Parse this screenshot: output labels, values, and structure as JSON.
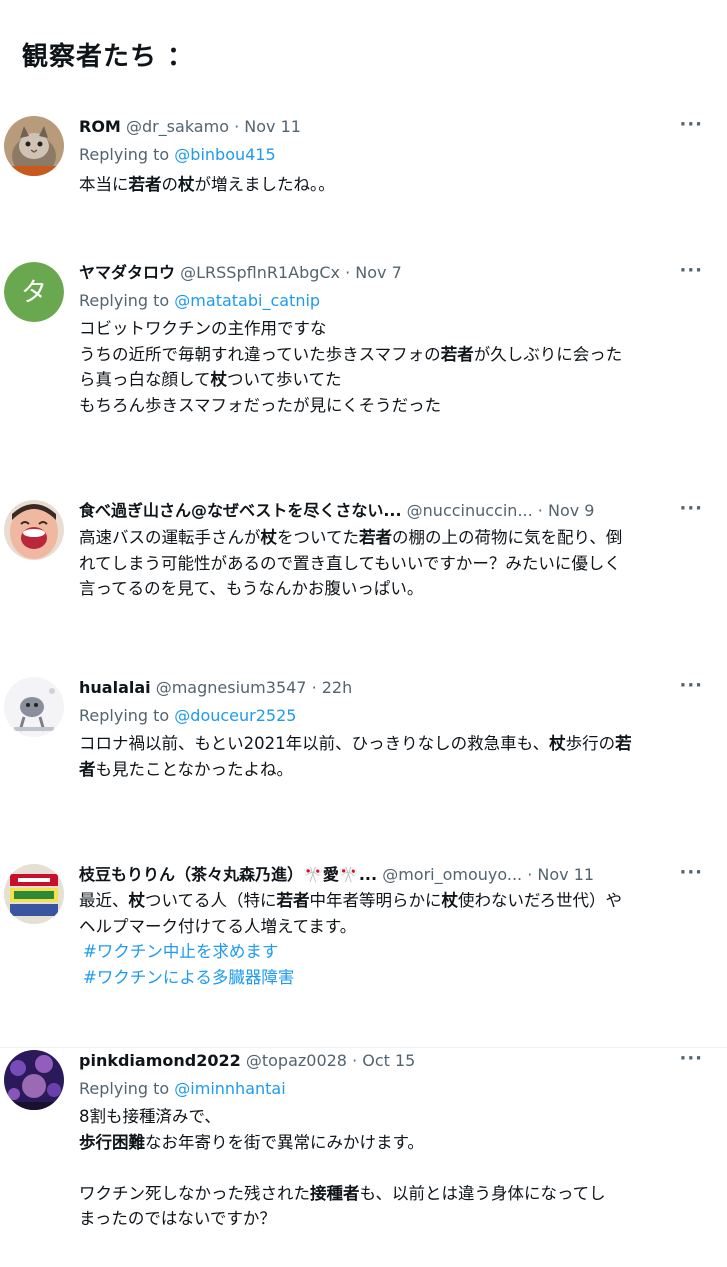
{
  "header": {
    "title": "観察者たち ："
  },
  "tweets": [
    {
      "name": "ROM",
      "handle": "@dr_sakamo",
      "sep": " · ",
      "date": "Nov 11",
      "reply_prefix": "Replying to ",
      "reply_to": "@binbou415",
      "lines": [
        [
          "本当に",
          "若者",
          "の",
          "杖",
          "が増えましたね。。"
        ]
      ]
    },
    {
      "name": "ヤマダタロウ",
      "handle": "@LRSSpflnR1AbgCx",
      "sep": " · ",
      "date": "Nov 7",
      "avatar_letter": "タ",
      "reply_prefix": "Replying to ",
      "reply_to": "@matatabi_catnip",
      "lines": [
        [
          "コビットワクチンの主作用ですな"
        ],
        [
          "うちの近所で毎朝すれ違っていた歩きスマフォの",
          "若者",
          "が久しぶりに会った"
        ],
        [
          "ら真っ白な顔して",
          "杖",
          "ついて歩いてた"
        ],
        [
          "もちろん歩きスマフォだったが見にくそうだった"
        ]
      ]
    },
    {
      "name": "食べ過ぎ山さん@なぜベストを尽くさない...",
      "handle": "@nuccinuccin...",
      "sep": " · ",
      "date": "Nov 9",
      "lines": [
        [
          "高速バスの運転手さんが",
          "杖",
          "をついてた",
          "若者",
          "の棚の上の荷物に気を配り、倒"
        ],
        [
          "れてしまう可能性があるので置き直してもいいですかー？みたいに優しく"
        ],
        [
          "言ってるのを見て、もうなんかお腹いっぱい。"
        ]
      ]
    },
    {
      "name": "hualalai",
      "handle": "@magnesium3547",
      "sep": " · ",
      "date": "22h",
      "reply_prefix": "Replying to ",
      "reply_to": "@douceur2525",
      "lines": [
        [
          "コロナ禍以前、もとい2021年以前、ひっきりなしの救急車も、",
          "杖",
          "歩行の",
          "若"
        ],
        [
          "",
          "者",
          "も見たことなかったよね。"
        ]
      ]
    },
    {
      "name": "枝豆もりりん（茶々丸森乃進）🎌愛🎌...",
      "handle": "@mori_omouyo...",
      "sep": " · ",
      "date": "Nov 11",
      "lines": [
        [
          "最近、",
          "杖",
          "ついてる人（特に",
          "若者",
          "中年者等明らかに",
          "杖",
          "使わないだろ世代）や"
        ],
        [
          "ヘルプマーク付けてる人増えてます。"
        ]
      ],
      "hashtags": [
        "#ワクチン中止を求めます",
        "#ワクチンによる多臓器障害"
      ]
    },
    {
      "name": "pinkdiamond2022",
      "handle": "@topaz0028",
      "sep": " · ",
      "date": "Oct 15",
      "reply_prefix": "Replying to ",
      "reply_to": "@iminnhantai",
      "lines": [
        [
          "8割も接種済みで、"
        ],
        [
          "",
          "歩行困難",
          "なお年寄りを街で異常にみかけます。"
        ],
        [
          " "
        ],
        [
          "ワクチン死しなかった残された",
          "接種者",
          "も、以前とは違う身体になってし"
        ],
        [
          "まったのではないですか？"
        ]
      ]
    }
  ],
  "more_label": "···",
  "colors": {
    "text": "#0f1419",
    "muted": "#536471",
    "link": "#1d9bf0",
    "avatar_green": "#6aa84f"
  }
}
